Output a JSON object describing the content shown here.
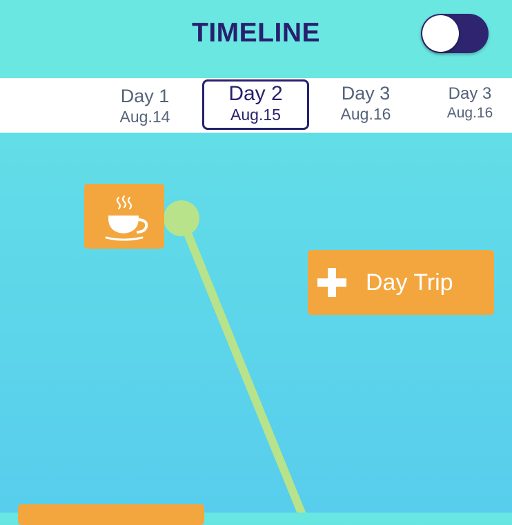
{
  "header": {
    "title": "TIMELINE",
    "toggle_on": false
  },
  "days": [
    {
      "day": "Day 1",
      "date": "Aug.14"
    },
    {
      "day": "Day 2",
      "date": "Aug.15",
      "selected": true
    },
    {
      "day": "Day 3",
      "date": "Aug.16"
    },
    {
      "day": "Day 3",
      "date": "Aug.16"
    }
  ],
  "timeline": {
    "cafe_icon": "coffee-cup-icon",
    "day_trip_label": "Day Trip",
    "day_trip_icon": "plus-icon"
  },
  "colors": {
    "navy": "#27206E",
    "orange": "#F3A63D",
    "line": "#B8E38A",
    "teal": "#6AE7E1"
  }
}
